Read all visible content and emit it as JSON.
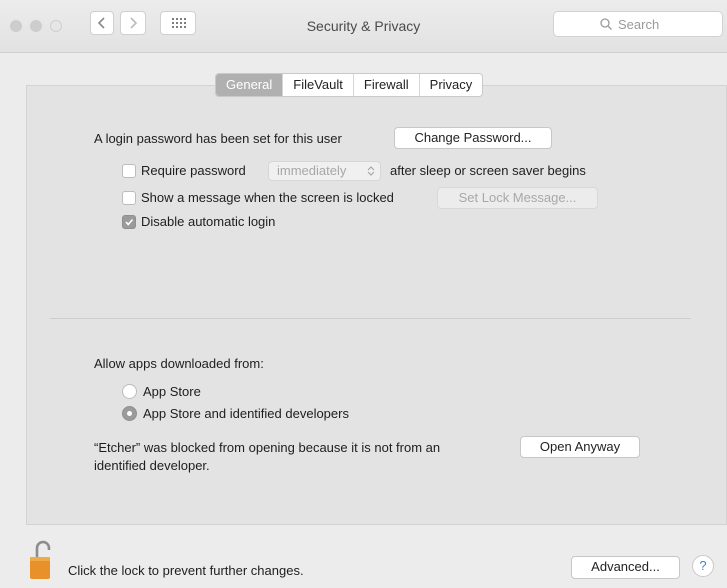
{
  "window": {
    "title": "Security & Privacy",
    "search_placeholder": "Search"
  },
  "tabs": [
    {
      "label": "General",
      "active": true
    },
    {
      "label": "FileVault",
      "active": false
    },
    {
      "label": "Firewall",
      "active": false
    },
    {
      "label": "Privacy",
      "active": false
    }
  ],
  "general": {
    "login_password_text": "A login password has been set for this user",
    "change_password_label": "Change Password...",
    "require_password": {
      "label": "Require password",
      "checked": false,
      "select_value": "immediately",
      "suffix": "after sleep or screen saver begins"
    },
    "show_message": {
      "label": "Show a message when the screen is locked",
      "checked": false,
      "button_label": "Set Lock Message..."
    },
    "disable_auto_login": {
      "label": "Disable automatic login",
      "checked": true
    }
  },
  "gatekeeper": {
    "heading": "Allow apps downloaded from:",
    "options": [
      {
        "label": "App Store",
        "selected": false
      },
      {
        "label": "App Store and identified developers",
        "selected": true
      }
    ],
    "blocked_line1": "“Etcher” was blocked from opening because it is not from an",
    "blocked_line2": "identified developer.",
    "open_anyway_label": "Open Anyway"
  },
  "footer": {
    "lock_text": "Click the lock to prevent further changes.",
    "advanced_label": "Advanced...",
    "help_label": "?"
  },
  "colors": {
    "window_bg": "#ececec",
    "panel_bg": "#e3e3e3",
    "selected_tab": "#b0b0b0",
    "lock_body": "#e8902a"
  }
}
